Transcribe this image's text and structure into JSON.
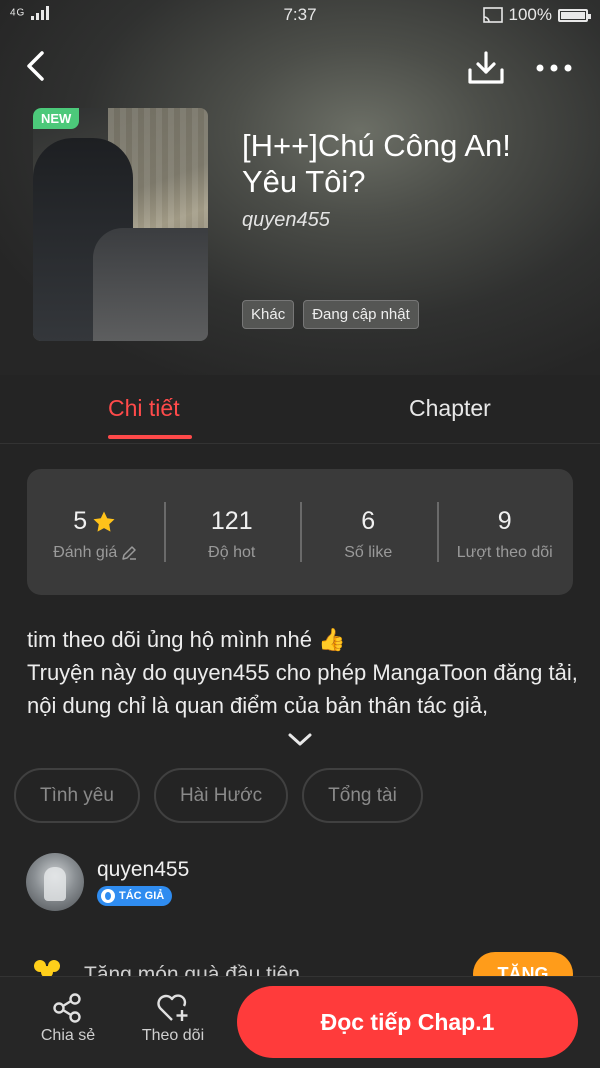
{
  "status_bar": {
    "network": "4G",
    "time": "7:37",
    "battery": "100%"
  },
  "header": {
    "back_icon": "chevron-left-icon",
    "download_icon": "download-icon",
    "more_icon": "more-dots-icon"
  },
  "book": {
    "badge": "NEW",
    "title": "[H++]Chú Công An! Yêu Tôi?",
    "author": "quyen455",
    "tags": [
      "Khác",
      "Đang cập nhật"
    ]
  },
  "tabs": [
    {
      "label": "Chi tiết",
      "active": true
    },
    {
      "label": "Chapter",
      "active": false
    }
  ],
  "stats": [
    {
      "value": "5",
      "label": "Đánh giá"
    },
    {
      "value": "121",
      "label": "Độ hot"
    },
    {
      "value": "6",
      "label": "Số like"
    },
    {
      "value": "9",
      "label": "Lượt theo dõi"
    }
  ],
  "description": {
    "line1": "tim theo dõi ủng hộ mình nhé 👍",
    "line2": "Truyện này do quyen455 cho phép MangaToon đăng tải, nội dung chỉ là quan điểm của bản thân tác giả,"
  },
  "genres": [
    "Tình yêu",
    "Hài Hước",
    "Tổng tài"
  ],
  "author_card": {
    "name": "quyen455",
    "badge": "TÁC GIẢ"
  },
  "gift": {
    "text": "Tặng món quà đầu tiên",
    "button": "TẶNG"
  },
  "bottom_bar": {
    "share_label": "Chia sẻ",
    "follow_label": "Theo dõi",
    "read_label": "Đọc tiếp Chap.1"
  },
  "colors": {
    "accent": "#ff3b3b",
    "new_badge": "#4cc97a",
    "gift_button": "#ff9c1a",
    "author_badge": "#2f8cf0"
  }
}
